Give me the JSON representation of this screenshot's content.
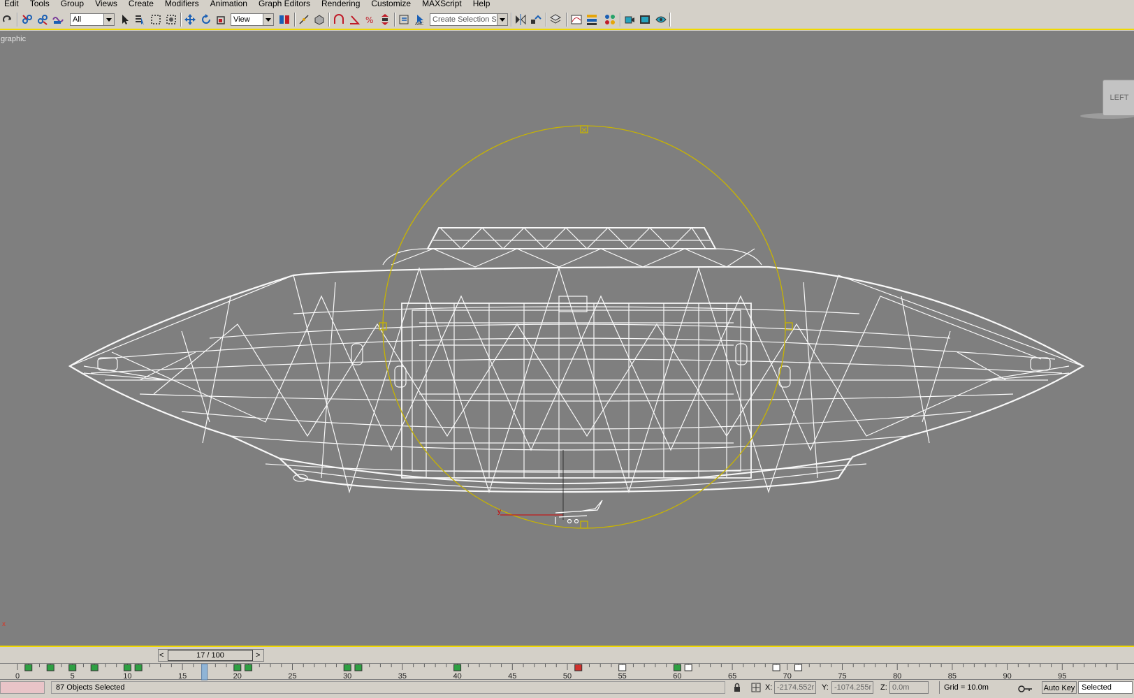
{
  "menu": [
    "Edit",
    "Tools",
    "Group",
    "Views",
    "Create",
    "Modifiers",
    "Animation",
    "Graph Editors",
    "Rendering",
    "Customize",
    "MAXScript",
    "Help"
  ],
  "toolbar": {
    "filter_value": "All",
    "coord_system": "View",
    "selection_set_placeholder": "Create Selection Set",
    "icons": [
      "redo-icon",
      "link-icon",
      "unlink-icon",
      "bind-space-warp-icon",
      "select-object-icon",
      "select-by-name-icon",
      "rectangular-selection-icon",
      "window-crossing-icon",
      "move-icon",
      "rotate-icon",
      "scale-icon",
      "pivot-icon",
      "manipulate-icon",
      "keyboard-shortcut-icon",
      "snaps-icon",
      "angle-snap-icon",
      "percent-snap-icon",
      "spinner-snap-icon",
      "named-selection-icon",
      "edit-named-selection-icon",
      "mirror-icon",
      "align-icon",
      "layer-manager-icon",
      "curve-editor-icon",
      "schematic-view-icon",
      "material-editor-icon",
      "render-setup-icon",
      "rendered-frame-icon",
      "quick-render-icon"
    ]
  },
  "viewport": {
    "label": "graphic",
    "viewcube_label": "LEFT",
    "axis_label": "x",
    "gizmo_axis": "y",
    "background": "#7f7f7f",
    "wire_color": "#ffffff",
    "selection_color": "#c8b400"
  },
  "time_slider": {
    "frame_display": "17 / 100",
    "current_frame": 17,
    "total_frames": 100,
    "prev_label": "<",
    "next_label": ">"
  },
  "timeline": {
    "tick_labels": [
      "0",
      "5",
      "10",
      "15",
      "20",
      "25",
      "30",
      "35",
      "40",
      "45",
      "50",
      "55",
      "60",
      "65",
      "70",
      "75",
      "80",
      "85",
      "90",
      "95"
    ],
    "keys": [
      {
        "frame": 1,
        "color": "green"
      },
      {
        "frame": 3,
        "color": "green"
      },
      {
        "frame": 5,
        "color": "green"
      },
      {
        "frame": 7,
        "color": "green"
      },
      {
        "frame": 10,
        "color": "green"
      },
      {
        "frame": 11,
        "color": "green"
      },
      {
        "frame": 20,
        "color": "green"
      },
      {
        "frame": 21,
        "color": "green"
      },
      {
        "frame": 30,
        "color": "green"
      },
      {
        "frame": 31,
        "color": "green"
      },
      {
        "frame": 40,
        "color": "green"
      },
      {
        "frame": 51,
        "color": "red"
      },
      {
        "frame": 55,
        "color": "white"
      },
      {
        "frame": 60,
        "color": "green"
      },
      {
        "frame": 61,
        "color": "white"
      },
      {
        "frame": 69,
        "color": "white"
      },
      {
        "frame": 71,
        "color": "white"
      }
    ]
  },
  "status": {
    "message": "87 Objects Selected",
    "x_label": "X:",
    "x_value": "-2174.552r",
    "y_label": "Y:",
    "y_value": "-1074.255r",
    "z_label": "Z:",
    "z_value": "0.0m",
    "grid": "Grid = 10.0m",
    "auto_key": "Auto Key",
    "key_mode": "Selected"
  }
}
